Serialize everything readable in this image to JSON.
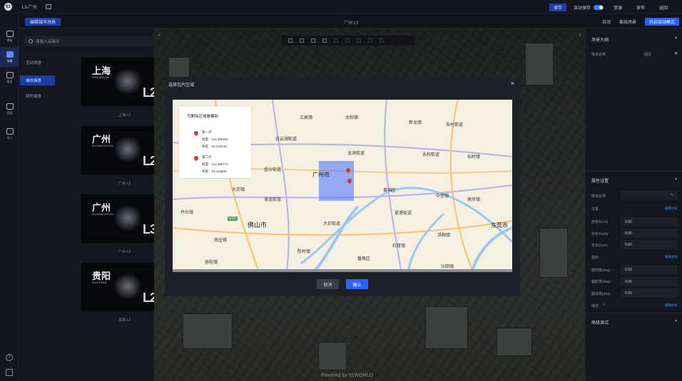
{
  "app": {
    "logo_text": "51",
    "project_title": "L3-广州",
    "save_label": "保存",
    "autosave_label": "自动保存",
    "autosave_on": true,
    "top_links": [
      "资源",
      "发布",
      "返回"
    ]
  },
  "subbar": {
    "edit_scene_label": "编辑城市场景",
    "scene_title": "广州 L3",
    "links": [
      "自动",
      "离线场景"
    ],
    "mode_button": "开启自动模式"
  },
  "rail": {
    "items": [
      {
        "label": "模板",
        "icon": "folder-icon",
        "active": false
      },
      {
        "label": "场景",
        "icon": "city-icon",
        "active": true
      },
      {
        "label": "模型",
        "icon": "cube-icon",
        "active": false
      },
      {
        "label": "图层",
        "icon": "grid-icon",
        "active": false
      },
      {
        "label": "导入",
        "icon": "import-icon",
        "active": false
      }
    ]
  },
  "scene_panel": {
    "search_placeholder": "请输入关键词",
    "categories": [
      {
        "label": "互动场景",
        "active": false
      },
      {
        "label": "城市场景",
        "active": true
      },
      {
        "label": "我的场景",
        "active": false
      }
    ],
    "cards": [
      {
        "city": "上海",
        "en": "SHANGHAI",
        "level": "L2",
        "caption": "上海 L2"
      },
      {
        "city": "广州",
        "en": "GUANGZHOU",
        "level": "L2",
        "caption": "广州 L2"
      },
      {
        "city": "广州",
        "en": "GUANGZHOU",
        "level": "L3",
        "caption": "广州 L3"
      },
      {
        "city": "贵阳",
        "en": "GUIYANG",
        "level": "L2",
        "caption": "贵阳 L2"
      }
    ]
  },
  "viewport": {
    "powered_by": "Powered by 51WORLD"
  },
  "right_panel": {
    "section1_title": "场景大纲",
    "section1_label": "物体名称",
    "section1_value": "图层",
    "section2_title": "属性设置",
    "props": [
      {
        "label": "物体名称",
        "value": ""
      },
      {
        "label": "位置",
        "value": "",
        "link": "编辑坐标"
      },
      {
        "label": "坐标X(cm)",
        "value": "0.00"
      },
      {
        "label": "坐标Y(cm)",
        "value": "0.00"
      },
      {
        "label": "坐标Z(cm)",
        "value": "0.00"
      },
      {
        "label": "旋转",
        "value": "",
        "link": "编辑坐标"
      },
      {
        "label": "俯仰角(deg)",
        "value": "0.00"
      },
      {
        "label": "偏航角(deg)",
        "value": "0.00"
      },
      {
        "label": "翻滚角(deg)",
        "value": "0.00"
      },
      {
        "label": "缩放",
        "value": "",
        "link": "编辑坐标"
      }
    ],
    "section3_title": "高级调试"
  },
  "modal": {
    "title": "选择瓦片区域",
    "close": "×",
    "cancel": "取消",
    "confirm": "确认",
    "info": {
      "title": "可删除区域看模拟",
      "point1_label": "第一点",
      "point1_lng": "经度：113.359202",
      "point1_lat": "纬度：23.133149",
      "point2_label": "第二点",
      "point2_lng": "经度：113.366773",
      "point2_lat": "纬度：23.113669"
    },
    "map_labels": [
      "江高镇",
      "太和镇",
      "新龙镇",
      "朱村街道",
      "白云湖街道",
      "龙洞街道",
      "永和街道",
      "仙村镇",
      "金沙街道",
      "广州市",
      "大沥镇",
      "黄埔区",
      "中堂镇",
      "丹灶镇",
      "海龙街道",
      "高埗镇",
      "佛山市",
      "大石街道",
      "夏港街道",
      "东莞市",
      "南庄镇",
      "洪梅镇",
      "陈村镇",
      "石楼镇",
      "番禺区",
      "沙田镇",
      "容桂镇",
      "515"
    ]
  }
}
